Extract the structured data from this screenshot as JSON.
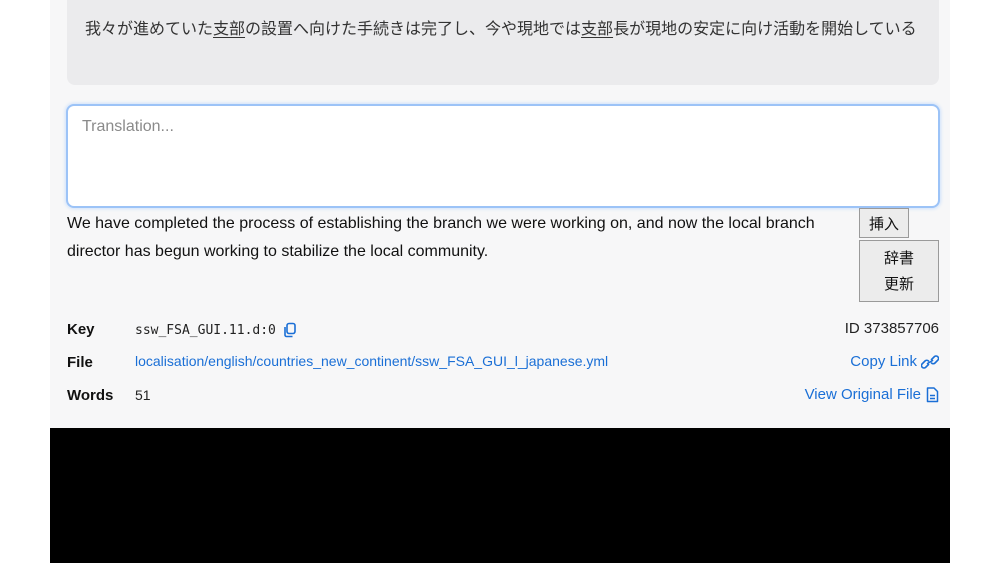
{
  "source": {
    "segments": [
      {
        "text": "我々が進めていた",
        "term": false
      },
      {
        "text": "支部",
        "term": true
      },
      {
        "text": "の設置へ向けた手続きは完了し、今や現地では",
        "term": false
      },
      {
        "text": "支部",
        "term": true
      },
      {
        "text": "長が現地の安定に向け活動を開始している",
        "term": false
      }
    ]
  },
  "translation": {
    "placeholder": "Translation...",
    "value": ""
  },
  "suggestion": {
    "text": "We have completed the process of establishing the branch we were working on, and now the local branch director has begun working to stabilize the local community.",
    "insert_label": "挿入",
    "dict_label": "辞書更新"
  },
  "meta": {
    "key_label": "Key",
    "key_value": "ssw_FSA_GUI.11.d:0",
    "file_label": "File",
    "file_path": "localisation/english/countries_new_continent/ssw_FSA_GUI_l_japanese.yml",
    "words_label": "Words",
    "words_value": "51",
    "id_text": "ID 373857706",
    "copy_link_label": "Copy Link",
    "view_original_label": "View Original File"
  },
  "colors": {
    "link": "#1a6fd6",
    "input_border": "#9cc3f7",
    "panel": "#f7f7f8",
    "source_box": "#ebebed"
  },
  "icons": {
    "key_copy": "copy-icon",
    "copy_link": "link-icon",
    "view_original": "file-icon"
  }
}
